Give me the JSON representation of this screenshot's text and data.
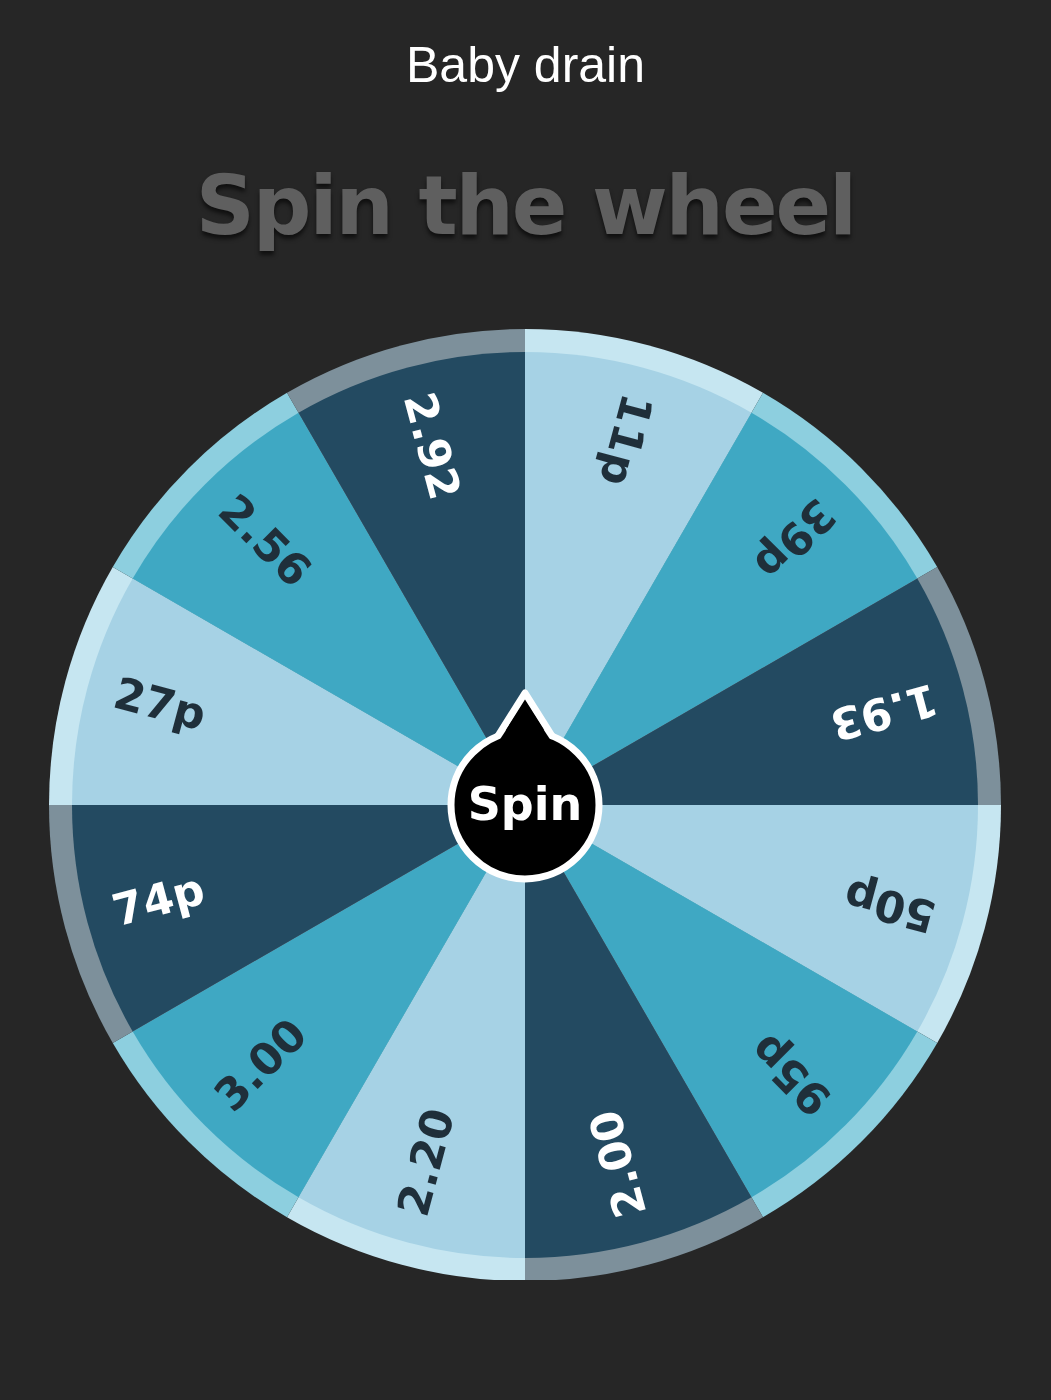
{
  "title": "Baby drain",
  "heading": "Spin the wheel",
  "wheel": {
    "segments": [
      {
        "label": "11p",
        "kind": "light"
      },
      {
        "label": "39p",
        "kind": "mid"
      },
      {
        "label": "1.93",
        "kind": "dark"
      },
      {
        "label": "50p",
        "kind": "light"
      },
      {
        "label": "95p",
        "kind": "mid"
      },
      {
        "label": "2.00",
        "kind": "dark"
      },
      {
        "label": "2.20",
        "kind": "light"
      },
      {
        "label": "3.00",
        "kind": "mid"
      },
      {
        "label": "74p",
        "kind": "dark"
      },
      {
        "label": "27p",
        "kind": "light"
      },
      {
        "label": "2.56",
        "kind": "mid"
      },
      {
        "label": "2.92",
        "kind": "dark"
      }
    ]
  },
  "spin_button": {
    "label": "Spin"
  }
}
